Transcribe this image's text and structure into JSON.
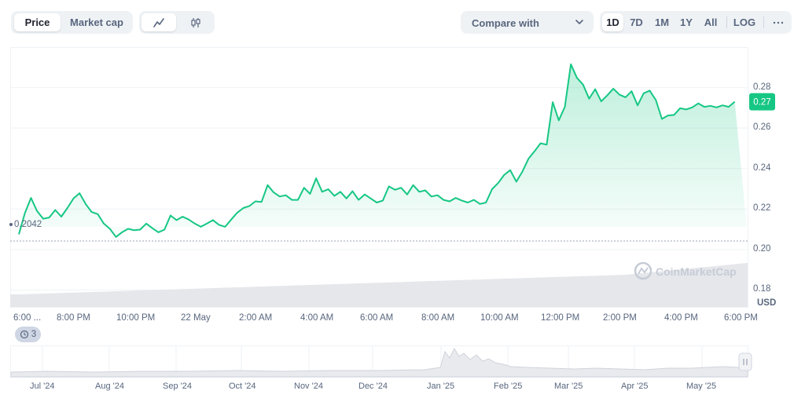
{
  "toolbar": {
    "tabs": [
      {
        "label": "Price",
        "active": true
      },
      {
        "label": "Market cap",
        "active": false
      }
    ],
    "chart_types": [
      {
        "icon": "line-chart-icon",
        "active": true
      },
      {
        "icon": "candlestick-icon",
        "active": false
      }
    ],
    "compare_label": "Compare with",
    "ranges": [
      {
        "label": "1D",
        "active": true
      },
      {
        "label": "7D"
      },
      {
        "label": "1M"
      },
      {
        "label": "1Y"
      },
      {
        "label": "All"
      }
    ],
    "log_label": "LOG",
    "more_icon": "more-horizontal-icon"
  },
  "chart_data": {
    "type": "area",
    "y_ticks": [
      "0.28",
      "0.26",
      "0.24",
      "0.22",
      "0.20",
      "0.18"
    ],
    "ylim": [
      0.172,
      0.3
    ],
    "y_unit": "USD",
    "current_price_label": "0.27",
    "open_price_label": "0.2042",
    "x_ticks": [
      "6:00 ...",
      "8:00 PM",
      "10:00 PM",
      "22 May",
      "2:00 AM",
      "4:00 AM",
      "6:00 AM",
      "8:00 AM",
      "10:00 AM",
      "12:00 PM",
      "2:00 PM",
      "4:00 PM",
      "6:00 PM"
    ],
    "series": [
      {
        "x_hours": [
          0,
          0.2,
          0.4,
          0.6,
          0.8,
          1.0,
          1.2,
          1.4,
          1.6,
          1.8,
          2.0,
          2.2,
          2.4,
          2.6,
          2.8,
          3.0,
          3.2,
          3.4,
          3.6,
          3.8,
          4.0,
          4.2,
          4.4,
          4.6,
          4.8,
          5.0,
          5.2,
          5.4,
          5.6,
          5.8,
          6.0,
          6.2,
          6.4,
          6.6,
          6.8,
          7.0,
          7.2,
          7.4,
          7.6,
          7.8,
          8.0,
          8.2,
          8.4,
          8.6,
          8.8,
          9.0,
          9.2,
          9.4,
          9.6,
          9.8,
          10.0,
          10.2,
          10.4,
          10.6,
          10.8,
          11.0,
          11.2,
          11.4,
          11.6,
          11.8,
          12.0,
          12.2,
          12.4,
          12.6,
          12.8,
          13.0,
          13.2,
          13.4,
          13.6,
          13.8,
          14.0,
          14.2,
          14.4,
          14.6,
          14.8,
          15.0,
          15.2,
          15.4,
          15.6,
          15.8,
          16.0,
          16.2,
          16.4,
          16.6,
          16.8,
          17.0,
          17.2,
          17.4,
          17.6,
          17.8,
          18.0,
          18.2,
          18.4,
          18.6,
          18.8,
          19.0,
          19.2,
          19.4,
          19.6,
          19.8,
          20.0,
          20.2,
          20.4,
          20.6,
          20.8,
          21.0,
          21.2,
          21.4,
          21.6,
          21.8,
          22.0,
          22.2,
          22.4,
          22.6,
          22.8,
          23.0,
          23.2,
          23.4,
          23.6,
          23.8,
          24.0
        ],
        "values": [
          0.2075,
          0.218,
          0.2255,
          0.219,
          0.2152,
          0.2158,
          0.2195,
          0.2162,
          0.2205,
          0.2252,
          0.2278,
          0.2225,
          0.2185,
          0.2175,
          0.2128,
          0.2102,
          0.2062,
          0.2085,
          0.2102,
          0.2095,
          0.2098,
          0.2128,
          0.2105,
          0.2085,
          0.2098,
          0.2168,
          0.2145,
          0.2162,
          0.2148,
          0.2128,
          0.2112,
          0.2128,
          0.2145,
          0.2122,
          0.2112,
          0.2148,
          0.2182,
          0.2205,
          0.2215,
          0.2238,
          0.2235,
          0.2318,
          0.2282,
          0.2262,
          0.2268,
          0.2245,
          0.2245,
          0.2305,
          0.2275,
          0.2352,
          0.2285,
          0.2298,
          0.2265,
          0.2285,
          0.2252,
          0.2288,
          0.2245,
          0.2272,
          0.2252,
          0.2232,
          0.2242,
          0.2312,
          0.2295,
          0.2305,
          0.2272,
          0.2318,
          0.2285,
          0.2292,
          0.2262,
          0.2268,
          0.2245,
          0.2238,
          0.2255,
          0.2242,
          0.2232,
          0.2245,
          0.2225,
          0.2232,
          0.2298,
          0.2328,
          0.2368,
          0.2392,
          0.2335,
          0.2385,
          0.2448,
          0.2485,
          0.2525,
          0.2518,
          0.2728,
          0.2638,
          0.2705,
          0.2915,
          0.2848,
          0.2815,
          0.2745,
          0.2792,
          0.2732,
          0.2762,
          0.2795,
          0.2765,
          0.2752,
          0.2782,
          0.2712,
          0.2772,
          0.2785,
          0.2738,
          0.2645,
          0.2662,
          0.2665,
          0.2698,
          0.2692,
          0.2702,
          0.2722,
          0.2705,
          0.271,
          0.2702,
          0.2712,
          0.2705,
          0.273
        ]
      }
    ],
    "volume_note": "volume area (grey) increasing across the day",
    "colors": {
      "line": "#16c784",
      "fill": "#16c784",
      "volume": "#e5e7eb",
      "label_bg": "#16c784"
    },
    "watermark": "CoinMarketCap",
    "events_badge": "3"
  },
  "navigator": {
    "months": [
      "Jul '24",
      "Aug '24",
      "Sep '24",
      "Oct '24",
      "Nov '24",
      "Dec '24",
      "Jan '25",
      "Feb '25",
      "Mar '25",
      "Apr '25",
      "May '25"
    ],
    "handle_icon": "drag-handle-icon"
  }
}
